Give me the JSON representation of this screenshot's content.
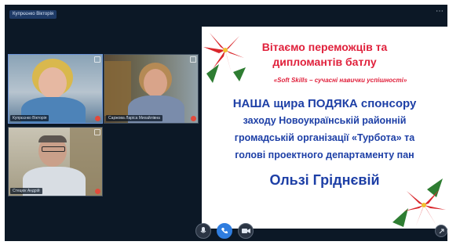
{
  "meeting": {
    "top_name": "Купрєєнко Вікторія",
    "more_icon": "more-icon"
  },
  "participants": [
    {
      "name": "Купрєєнко Вікторія",
      "muted": true
    },
    {
      "name": "Саржова Ларіса Михайлівна",
      "muted": true
    },
    {
      "name": "Стецюк Андрій",
      "muted": true
    }
  ],
  "slide": {
    "title_line1": "Вітаємо переможців та",
    "title_line2": "дипломантів батлу",
    "subtitle": "«Soft Skills – сучасні навички успішності»",
    "body_line1": "НАША щира ПОДЯКА спонсору",
    "body_line2": "заходу Новоукраїнській районній",
    "body_line3": "громадській організації «Турбота» та",
    "body_line4": "голові проектного департаменту пан",
    "name_line": "Ользі Гріднєвій"
  },
  "controls": [
    {
      "icon": "microphone-icon",
      "label": "Mute"
    },
    {
      "icon": "phone-icon",
      "label": "Leave"
    },
    {
      "icon": "camera-icon",
      "label": "Video"
    },
    {
      "icon": "expand-icon",
      "label": "Fullscreen"
    }
  ],
  "colors": {
    "slide_red": "#e0213c",
    "slide_blue": "#1d3fa6",
    "call_blue": "#2f7ddf",
    "mute_red": "#e24a3b",
    "frame_bg": "#0c1826"
  }
}
